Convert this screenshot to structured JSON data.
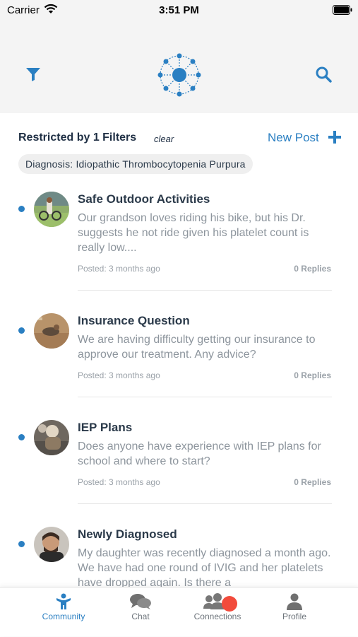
{
  "status_bar": {
    "carrier": "Carrier",
    "time": "3:51 PM"
  },
  "nav": {
    "left_icon": "filter-icon",
    "center_icon": "network-logo-icon",
    "right_icon": "search-icon"
  },
  "filters": {
    "title": "Restricted by 1 Filters",
    "clear_label": "clear",
    "new_post_label": "New Post",
    "chips": [
      "Diagnosis: Idiopathic Thrombocytopenia Purpura"
    ]
  },
  "posts": [
    {
      "title": "Safe Outdoor Activities",
      "body": "Our grandson loves riding his bike, but his Dr. suggests he not ride given his platelet count is really low....",
      "posted": "Posted: 3 months ago",
      "replies": "0 Replies"
    },
    {
      "title": "Insurance Question",
      "body": "We are having difficulty getting our insurance to approve our treatment. Any advice?",
      "posted": "Posted: 3 months ago",
      "replies": "0 Replies"
    },
    {
      "title": "IEP Plans",
      "body": "Does anyone have experience with IEP plans for school and where to start?",
      "posted": "Posted: 3 months ago",
      "replies": "0 Replies"
    },
    {
      "title": "Newly Diagnosed",
      "body": "My daughter was recently diagnosed a month ago. We have had one round of IVIG and her platelets have dropped again. Is there a",
      "posted": "",
      "replies": ""
    }
  ],
  "tabs": [
    {
      "label": "Community",
      "icon": "community-icon",
      "active": true
    },
    {
      "label": "Chat",
      "icon": "chat-icon",
      "active": false
    },
    {
      "label": "Connections",
      "icon": "connections-icon",
      "active": false
    },
    {
      "label": "Profile",
      "icon": "profile-icon",
      "active": false
    }
  ],
  "colors": {
    "accent": "#2a7fc2",
    "title_text": "#2b3a4a",
    "muted_text": "#8d959d",
    "badge": "#f24b3c",
    "nav_bg": "#f4f4f4"
  }
}
